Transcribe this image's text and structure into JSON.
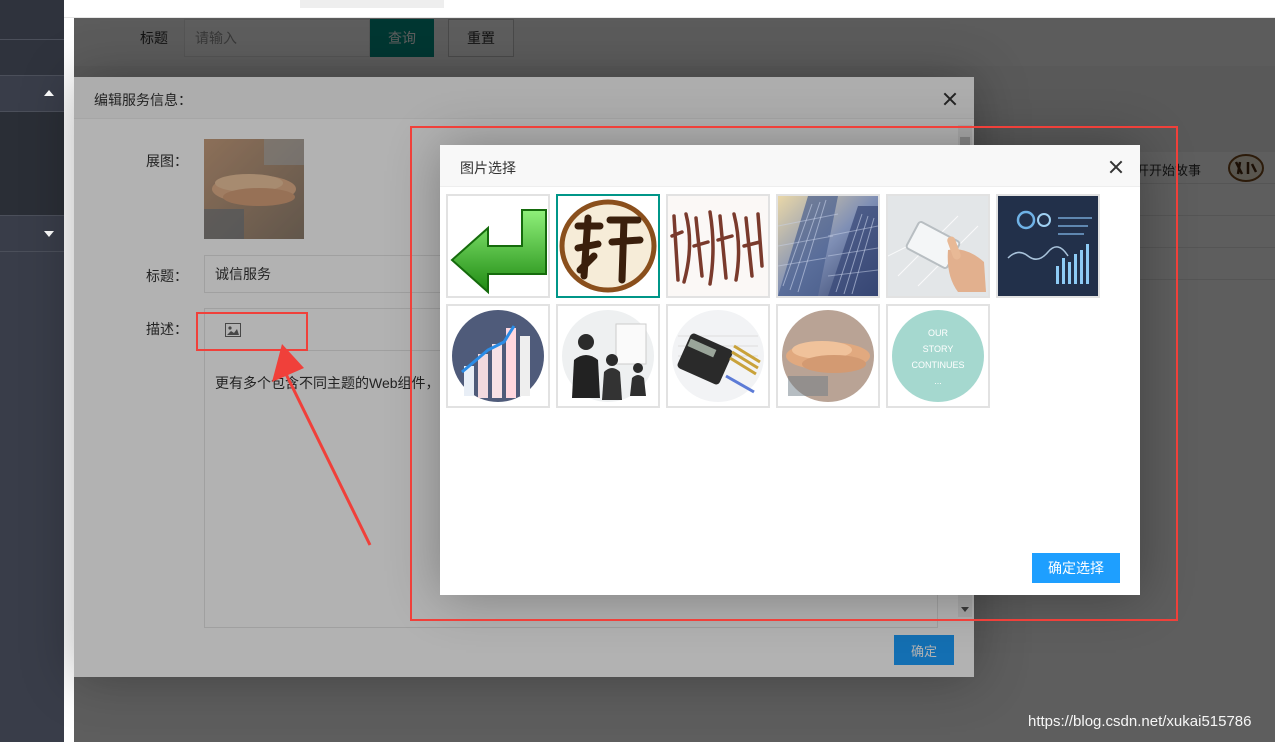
{
  "search": {
    "label": "标题",
    "placeholder": "请输入",
    "query_button": "查询",
    "reset_button": "重置"
  },
  "list": {
    "row_text": "开开始故事"
  },
  "edit_dialog": {
    "title": "编辑服务信息：",
    "image_label": "展图：",
    "title_label": "标题：",
    "title_value": "诚信服务",
    "desc_label": "描述：",
    "desc_text": "更有多个包含不同主题的Web组件，",
    "confirm_button": "确定"
  },
  "picker_dialog": {
    "title": "图片选择",
    "choose_button": "确定选择",
    "selected_index": 1,
    "images": [
      "green-return-arrow",
      "calligraphy-seal-xuan",
      "calligraphy-text",
      "skyscraper",
      "tablet-hand",
      "dashboard-infographic",
      "circle-bar-chart",
      "circle-business-meeting",
      "circle-calculator",
      "circle-hands",
      "circle-our-story"
    ],
    "story_text": "OUR STORY CONTINUES ..."
  },
  "watermark": "https://blog.csdn.net/xukai515786",
  "colors": {
    "sidebar": "#393d49",
    "teal": "#009688",
    "blue": "#1e9fff",
    "annotation_red": "#f0403a"
  }
}
